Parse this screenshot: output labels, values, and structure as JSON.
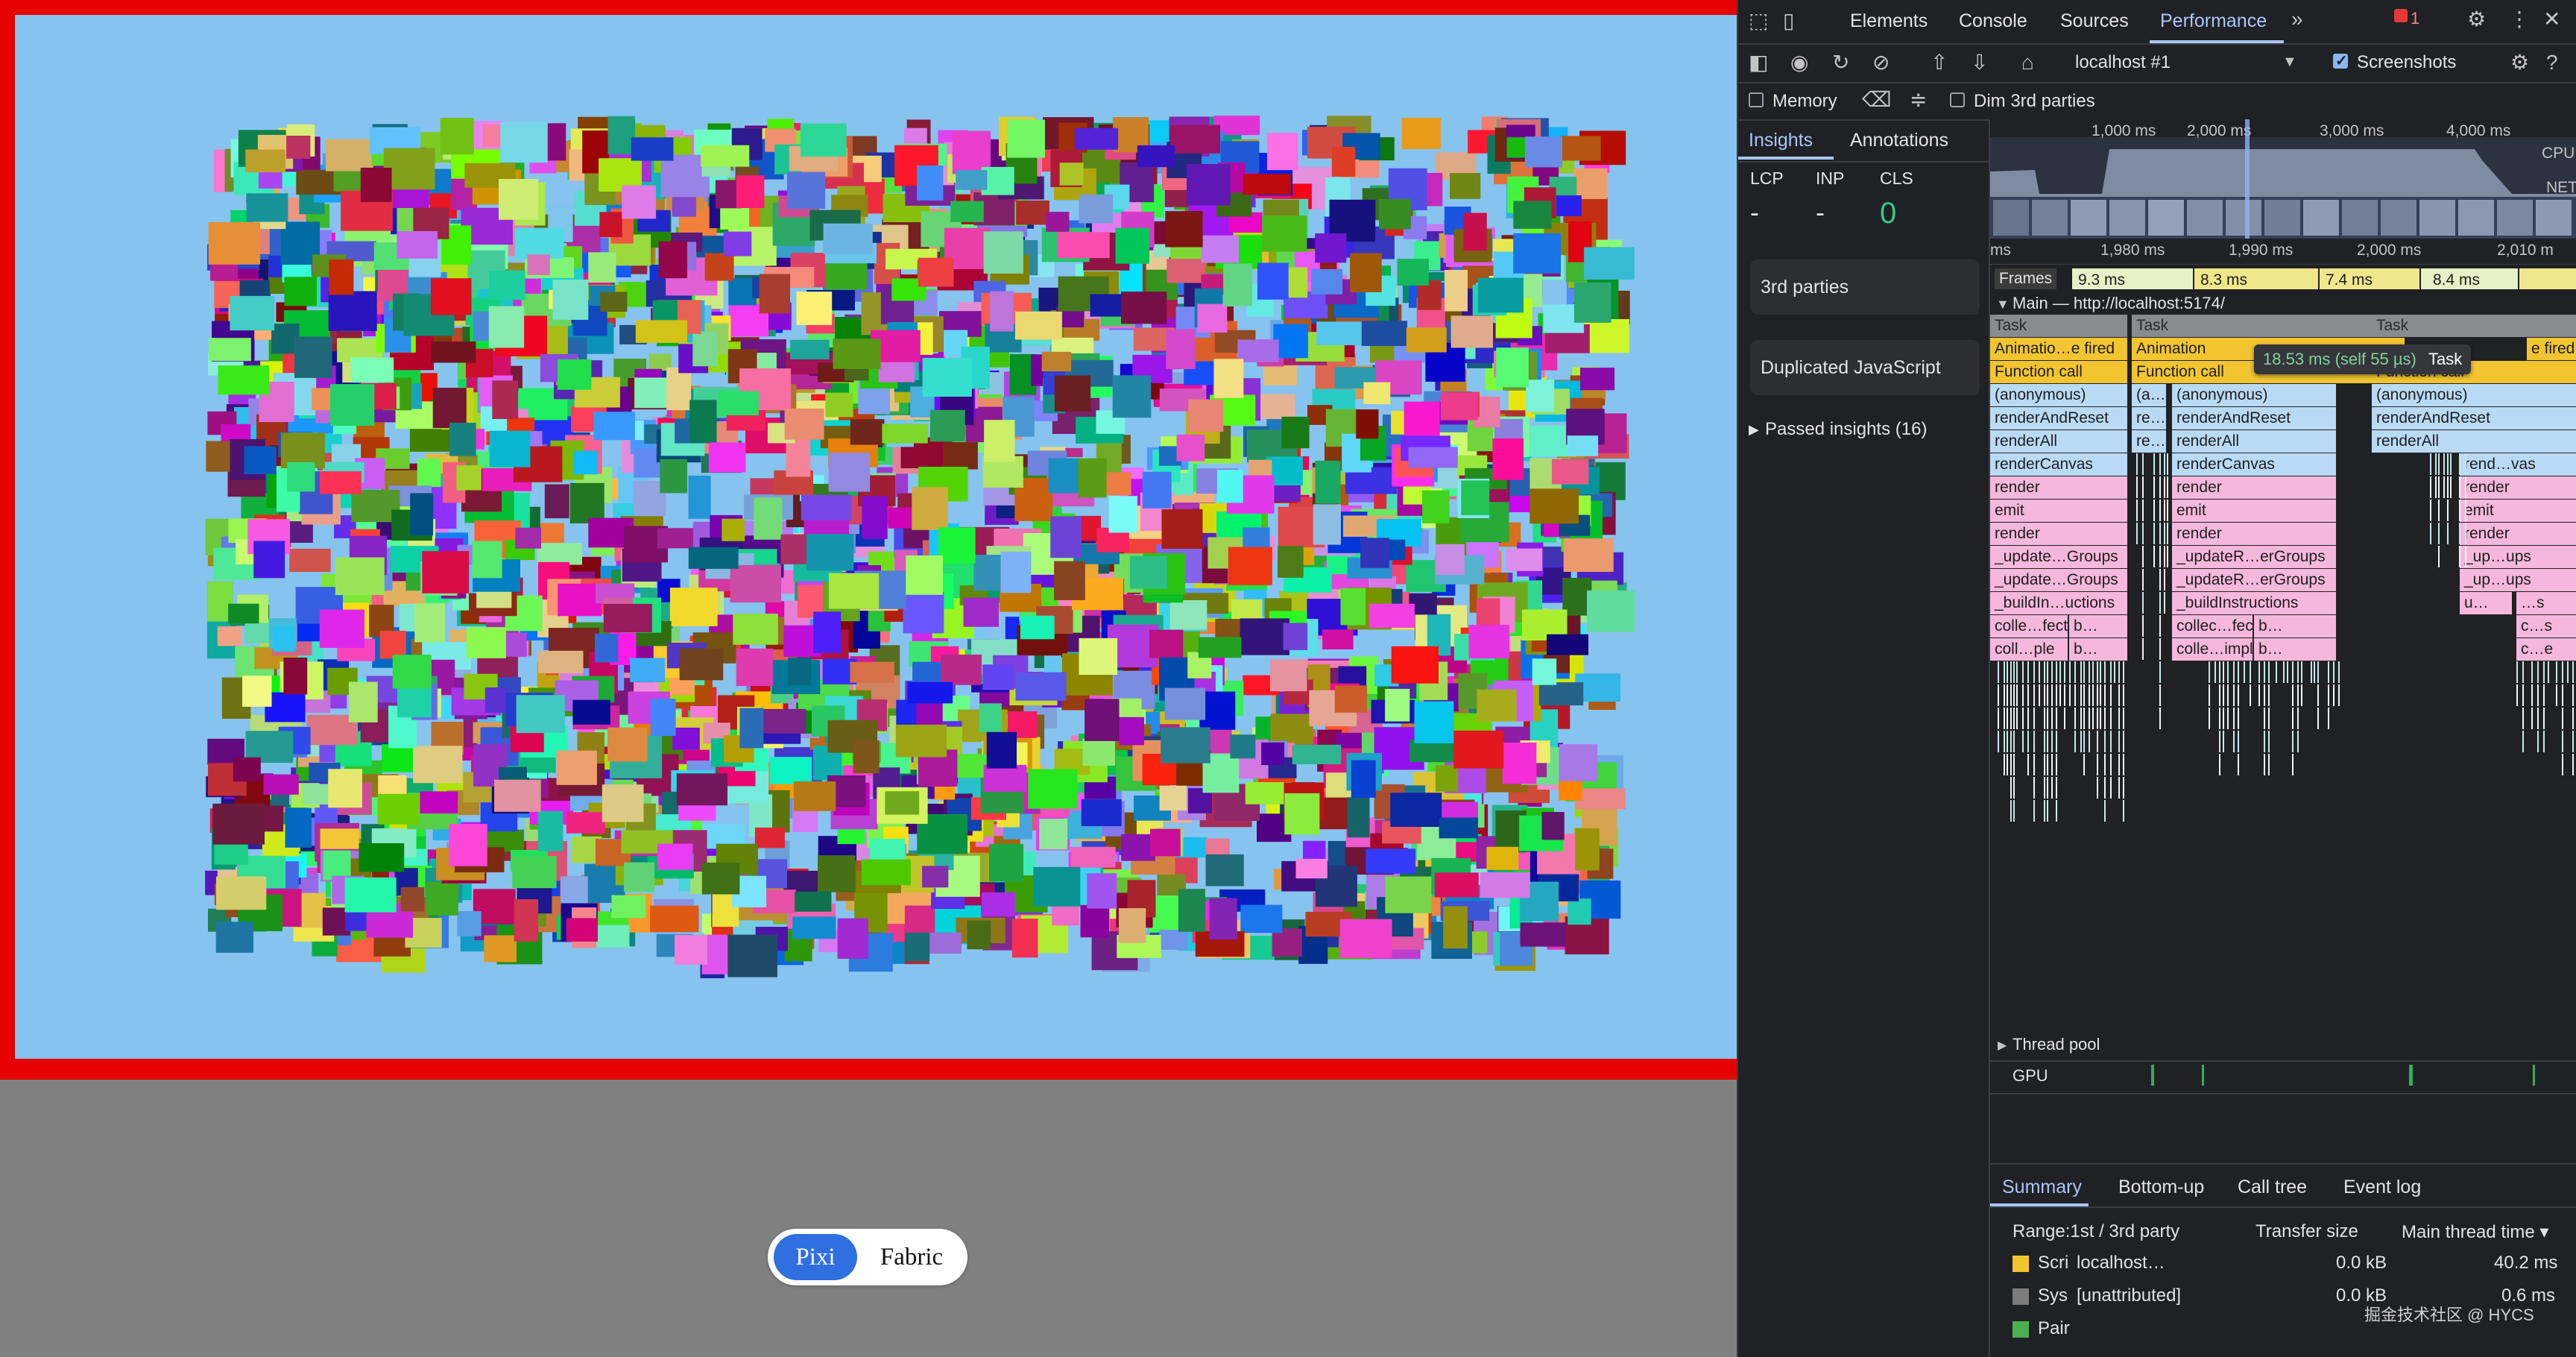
{
  "app": {
    "toggle": {
      "pixi": "Pixi",
      "fabric": "Fabric",
      "active": "Pixi"
    },
    "colors": {
      "border": "#e60000",
      "background": "#87c3ef",
      "page": "#808080",
      "toggle_active": "#2f6fe0"
    }
  },
  "devtools": {
    "tabs": [
      "Elements",
      "Console",
      "Sources",
      "Performance"
    ],
    "active_tab": "Performance",
    "more_tabs_icon": "»",
    "issues_badge": "1",
    "toolbar": {
      "target": "localhost #1",
      "screenshots_label": "Screenshots",
      "screenshots_checked": true
    },
    "toolbar2": {
      "memory_label": "Memory",
      "memory_checked": false,
      "dim_label": "Dim 3rd parties",
      "dim_checked": false
    },
    "side": {
      "tabs": [
        "Insights",
        "Annotations"
      ],
      "metrics": {
        "lcp_label": "LCP",
        "inp_label": "INP",
        "cls_label": "CLS",
        "lcp_value": "-",
        "inp_value": "-",
        "cls_value": "0"
      },
      "cards": [
        "3rd parties",
        "Duplicated JavaScript"
      ],
      "passed": "Passed insights (16)"
    },
    "overview": {
      "ticks": [
        "1,000 ms",
        "2,000 ms",
        "3,000 ms",
        "4,000 ms"
      ],
      "cpu_label": "CPU",
      "net_label": "NET"
    },
    "ruler": {
      "ticks": [
        "ms",
        "1,980 ms",
        "1,990 ms",
        "2,000 ms",
        "2,010 m"
      ]
    },
    "frames": {
      "label": "Frames",
      "values": [
        "9.3 ms",
        "8.3 ms",
        "7.4 ms",
        "8.4 ms"
      ]
    },
    "main_label": "Main — http://localhost:5174/",
    "tooltip": {
      "time": "18.53 ms (self 55 µs)",
      "name": "Task"
    },
    "flame": {
      "col1": [
        "Task",
        "Animatio…e fired",
        "Function call",
        "(anonymous)",
        "renderAndReset",
        "renderAll",
        "renderCanvas",
        "render",
        "emit",
        "render",
        "_update…Groups",
        "_update…Groups",
        "_buildIn…uctions",
        "colle…fects",
        "coll…ple"
      ],
      "col1_side": [
        "b…",
        "b…"
      ],
      "col2": [
        "Task",
        "Animation",
        "Function call",
        "(a…s)",
        "re…et",
        "re…ll"
      ],
      "col3": [
        "(anonymous)",
        "renderAndReset",
        "renderAll",
        "renderCanvas",
        "render",
        "emit",
        "render",
        "_updateR…erGroups",
        "_updateR…erGroups",
        "_buildInstructions",
        "collec…fects",
        "colle…imple"
      ],
      "col3_side": [
        "b…",
        "b…"
      ],
      "col4": [
        "Task",
        "e fired",
        "Function call",
        "(anonymous)",
        "renderAndReset",
        "renderAll",
        "rend…vas",
        "render",
        "emit",
        "render",
        "_up…ups",
        "_up…ups",
        "u…",
        "…s",
        "c…s",
        "c…e"
      ]
    },
    "thread_pool": "Thread pool",
    "gpu": "GPU",
    "bottom": {
      "tabs": [
        "Summary",
        "Bottom-up",
        "Call tree",
        "Event log"
      ],
      "headers": {
        "range": "Range:1st / 3rd party",
        "transfer": "Transfer size",
        "main": "Main thread time ▾"
      },
      "rows": [
        {
          "swatch": "#f2c530",
          "name": "Scri",
          "origin": "localhost…",
          "size": "0.0 kB",
          "time": "40.2 ms"
        },
        {
          "swatch": "#7c7c7c",
          "name": "Sys",
          "origin": "[unattributed]",
          "size": "0.0 kB",
          "time": "0.6 ms"
        },
        {
          "swatch": "#4caf50",
          "name": "Pair",
          "origin": "",
          "size": "",
          "time": ""
        }
      ]
    },
    "watermark": "掘金技术社区 @ HYCS"
  }
}
